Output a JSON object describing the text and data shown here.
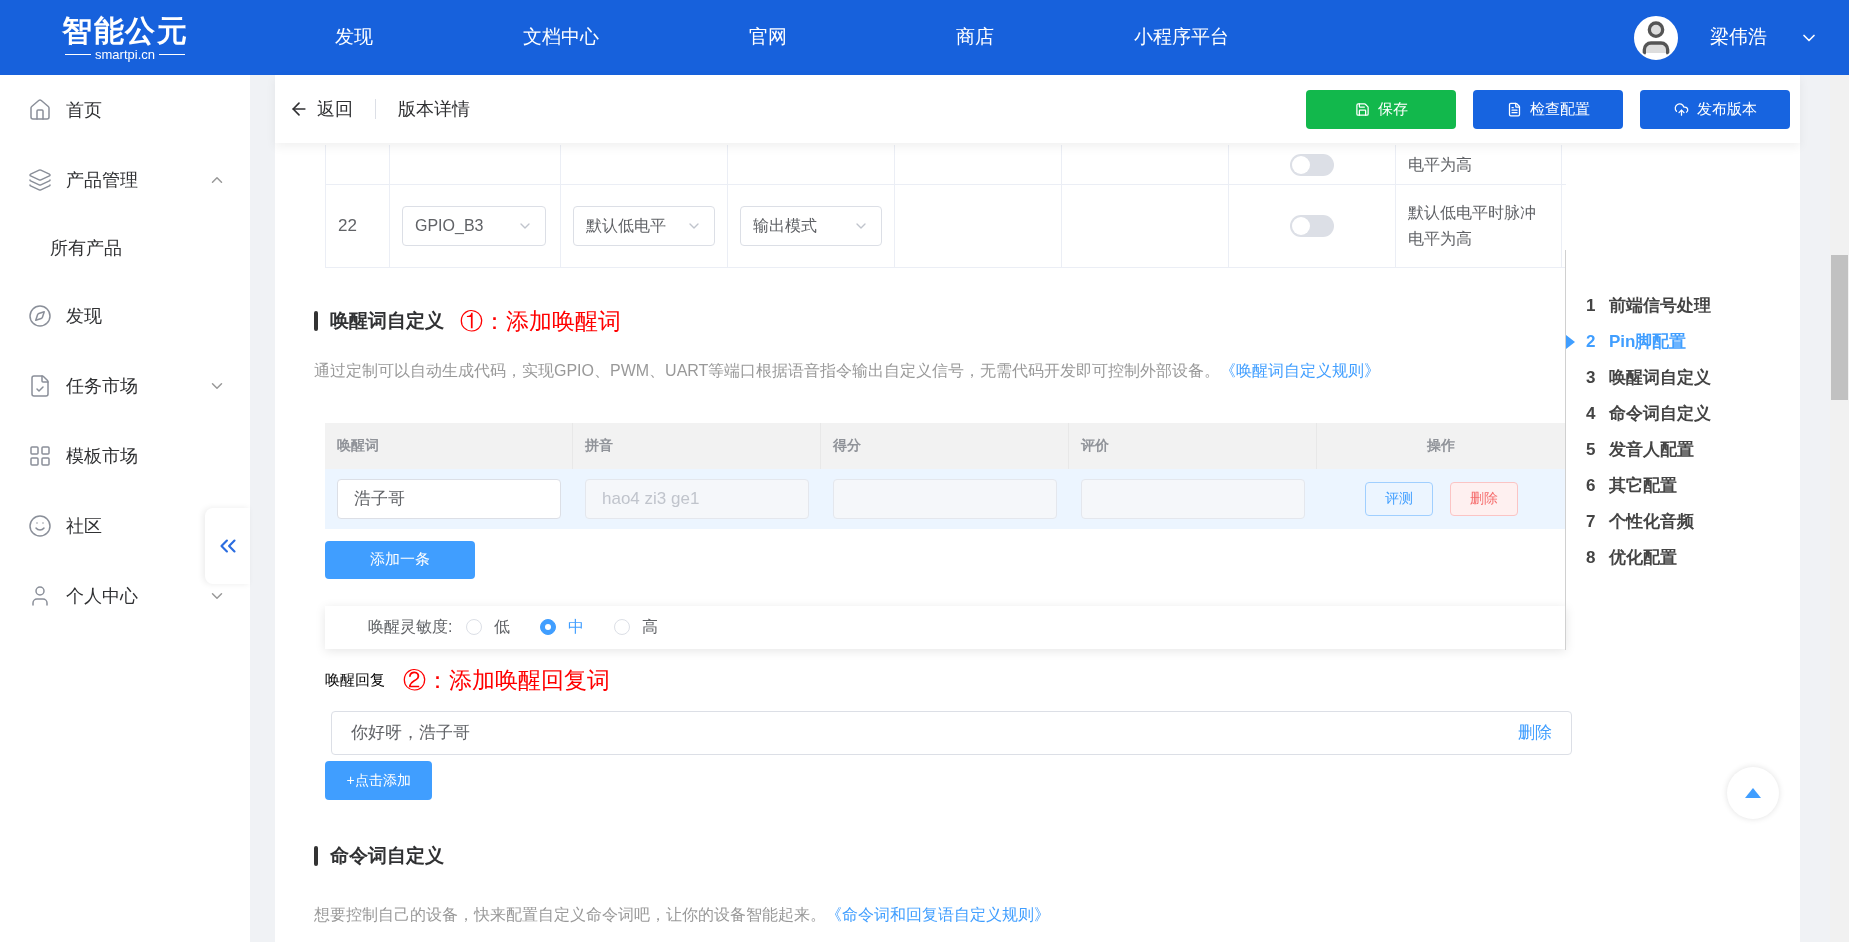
{
  "header": {
    "logo": {
      "name": "智能公元",
      "domain": "smartpi.cn"
    },
    "nav": [
      "发现",
      "文档中心",
      "官网",
      "商店",
      "小程序平台"
    ],
    "user": "梁伟浩"
  },
  "sidebar": {
    "items": [
      {
        "label": "首页",
        "kind": "link"
      },
      {
        "label": "产品管理",
        "kind": "group",
        "expanded": true,
        "children": [
          {
            "label": "所有产品"
          }
        ]
      },
      {
        "label": "发现",
        "kind": "link"
      },
      {
        "label": "任务市场",
        "kind": "group",
        "expanded": false
      },
      {
        "label": "模板市场",
        "kind": "link"
      },
      {
        "label": "社区",
        "kind": "link"
      },
      {
        "label": "个人中心",
        "kind": "group",
        "expanded": false
      }
    ]
  },
  "toolbar": {
    "back": "返回",
    "title": "版本详情",
    "buttons": [
      {
        "label": "保存",
        "kind": "success"
      },
      {
        "label": "检查配置",
        "kind": "primary"
      },
      {
        "label": "发布版本",
        "kind": "primary"
      }
    ]
  },
  "pin_table": {
    "rows": [
      {
        "kind": "partial",
        "on": false,
        "note": "电平为高"
      },
      {
        "kind": "full",
        "index": "22",
        "pin": "GPIO_B3",
        "default_level": "默认低电平",
        "mode": "输出模式",
        "on": false,
        "note": "默认低电平时脉冲电平为高"
      }
    ]
  },
  "wake_section": {
    "title": "唤醒词自定义",
    "annotation": "①：添加唤醒词",
    "description": "通过定制可以自动生成代码，实现GPIO、PWM、UART等端口根据语音指令输出自定义信号，无需代码开发即可控制外部设备。",
    "rule_link": "《唤醒词自定义规则》",
    "table": {
      "columns": [
        "唤醒词",
        "拼音",
        "得分",
        "评价",
        "操作"
      ],
      "rows": [
        {
          "word": "浩子哥",
          "pinyin": "hao4 zi3 ge1",
          "pinyin_disabled": true,
          "actions": [
            {
              "label": "评测",
              "kind": "primary"
            },
            {
              "label": "删除",
              "kind": "danger"
            }
          ]
        }
      ]
    },
    "add_button": "添加一条",
    "sensitivity": {
      "label": "唤醒灵敏度:",
      "options": [
        {
          "label": "低",
          "selected": false
        },
        {
          "label": "中",
          "selected": true
        },
        {
          "label": "高",
          "selected": false
        }
      ]
    },
    "reply": {
      "label": "唤醒回复",
      "annotation": "②：添加唤醒回复词",
      "items": [
        {
          "value": "你好呀，浩子哥",
          "action": "删除"
        }
      ],
      "add_button": "+点击添加"
    }
  },
  "command_section": {
    "title": "命令词自定义",
    "description": "想要控制自己的设备，快来配置自定义命令词吧，让你的设备智能起来。",
    "rule_link": "《命令词和回复语自定义规则》"
  },
  "outline": {
    "items": [
      {
        "number": "1",
        "label": "前端信号处理",
        "selected": false
      },
      {
        "number": "2",
        "label": "Pin脚配置",
        "selected": true
      },
      {
        "number": "3",
        "label": "唤醒词自定义",
        "selected": false
      },
      {
        "number": "4",
        "label": "命令词自定义",
        "selected": false
      },
      {
        "number": "5",
        "label": "发音人配置",
        "selected": false
      },
      {
        "number": "6",
        "label": "其它配置",
        "selected": false
      },
      {
        "number": "7",
        "label": "个性化音频",
        "selected": false
      },
      {
        "number": "8",
        "label": "优化配置",
        "selected": false
      }
    ]
  }
}
